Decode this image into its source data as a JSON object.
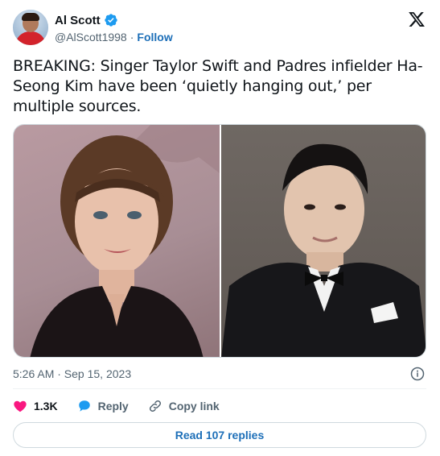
{
  "author": {
    "display_name": "Al Scott",
    "handle": "@AlScott1998",
    "separator": "·",
    "follow_label": "Follow",
    "verified": true
  },
  "platform_logo": "x-logo-icon",
  "tweet": {
    "text": "BREAKING: Singer Taylor Swift and Padres infielder Ha-Seong Kim have been ‘quietly hanging out,’ per multiple sources.",
    "timestamp": "5:26 AM · Sep 15, 2023"
  },
  "media": [
    {
      "name": "photo-left",
      "description_icon": "portrait-woman"
    },
    {
      "name": "photo-right",
      "description_icon": "portrait-man-tuxedo"
    }
  ],
  "actions": {
    "like_count": "1.3K",
    "reply_label": "Reply",
    "copy_link_label": "Copy link"
  },
  "read_replies_label": "Read 107 replies",
  "colors": {
    "link_blue": "#1d6fb8",
    "verified_blue": "#1d9bf0",
    "heart_pink": "#f91880",
    "text_primary": "#0f1419",
    "text_secondary": "#536471"
  }
}
